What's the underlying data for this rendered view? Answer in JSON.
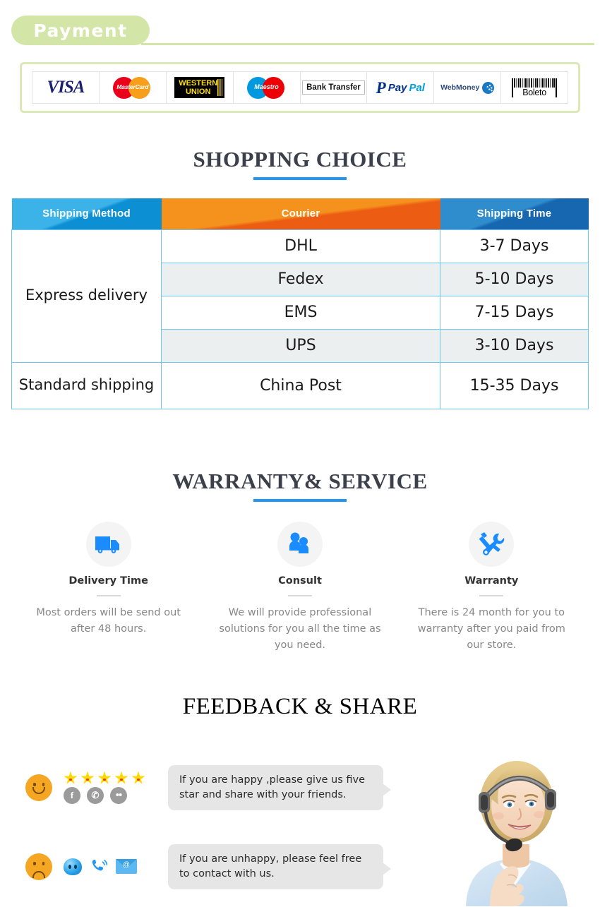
{
  "payment": {
    "badge_label": "Payment",
    "badge_color": "#d4e5a8",
    "methods": [
      {
        "name": "visa",
        "label": "VISA"
      },
      {
        "name": "mastercard",
        "label": "MasterCard"
      },
      {
        "name": "western-union",
        "line1": "WESTERN",
        "line2": "UNION"
      },
      {
        "name": "maestro",
        "label": "Maestro"
      },
      {
        "name": "bank-transfer",
        "label": "Bank Transfer"
      },
      {
        "name": "paypal",
        "label_pay": "Pay",
        "label_pal": "Pal",
        "mark": "P"
      },
      {
        "name": "webmoney",
        "label": "WebMoney"
      },
      {
        "name": "boleto",
        "label": "Boleto"
      }
    ]
  },
  "shopping": {
    "title": "SHOPPING CHOICE",
    "accent_color": "#2196f3",
    "headers": {
      "method": "Shipping Method",
      "courier": "Courier",
      "time": "Shipping Time"
    },
    "groups": [
      {
        "method": "Express delivery",
        "rows": [
          {
            "courier": "DHL",
            "time": "3-7  Days"
          },
          {
            "courier": "Fedex",
            "time": "5-10 Days"
          },
          {
            "courier": "EMS",
            "time": "7-15 Days"
          },
          {
            "courier": "UPS",
            "time": "3-10 Days"
          }
        ]
      },
      {
        "method": "Standard shipping",
        "rows": [
          {
            "courier": "China Post",
            "time": "15-35 Days"
          }
        ]
      }
    ]
  },
  "warranty": {
    "title": "WARRANTY& SERVICE",
    "accent_color": "#2196f3",
    "services": [
      {
        "icon": "delivery-truck-icon",
        "label": "Delivery Time",
        "desc": "Most orders will be send out after 48 hours."
      },
      {
        "icon": "consult-people-icon",
        "label": "Consult",
        "desc": "We will provide professional solutions for you all the time as you need."
      },
      {
        "icon": "tools-wrench-screwdriver-icon",
        "label": "Warranty",
        "desc": "There is  24  month for you to warranty after you paid from our store."
      }
    ]
  },
  "feedback": {
    "title": "FEEDBACK & SHARE",
    "happy": {
      "face": "smiley-face-icon",
      "star_count": 5,
      "socials": [
        {
          "name": "facebook-icon",
          "glyph": "f"
        },
        {
          "name": "twitter-icon",
          "glyph": "✆"
        },
        {
          "name": "flickr-icon",
          "glyph": "••"
        }
      ],
      "message": "If you are happy ,please give us five star and share with your friends."
    },
    "unhappy": {
      "face": "sad-face-icon",
      "contacts": [
        {
          "name": "msn-messenger-icon"
        },
        {
          "name": "phone-icon"
        },
        {
          "name": "email-icon",
          "glyph": "@"
        }
      ],
      "message": "If you are unhappy, please feel free to contact with us."
    },
    "agent_photo": "customer-service-agent-with-headset"
  }
}
